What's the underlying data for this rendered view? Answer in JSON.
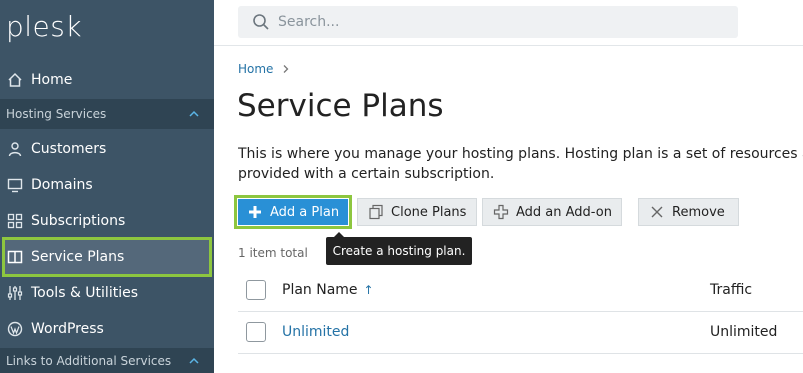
{
  "sidebar": {
    "logo": "plesk",
    "home": "Home",
    "hosting_section": "Hosting Services",
    "items": [
      {
        "label": "Customers",
        "icon": "user-icon"
      },
      {
        "label": "Domains",
        "icon": "monitor-icon"
      },
      {
        "label": "Subscriptions",
        "icon": "grid-icon"
      },
      {
        "label": "Service Plans",
        "icon": "book-icon"
      },
      {
        "label": "Tools & Utilities",
        "icon": "sliders-icon"
      },
      {
        "label": "WordPress",
        "icon": "wordpress-icon"
      }
    ],
    "links_section": "Links to Additional Services"
  },
  "search": {
    "placeholder": "Search..."
  },
  "breadcrumb": {
    "home": "Home"
  },
  "page": {
    "title": "Service Plans",
    "description_line1": "This is where you manage your hosting plans. Hosting plan is a set of resources and ser",
    "description_line2": "provided with a certain subscription."
  },
  "toolbar": {
    "add_plan": "Add a Plan",
    "clone_plans": "Clone Plans",
    "add_addon": "Add an Add-on",
    "remove": "Remove"
  },
  "tooltip": "Create a hosting plan.",
  "list": {
    "total": "1 item total",
    "columns": {
      "name": "Plan Name",
      "sort_indicator": "↑",
      "traffic": "Traffic"
    },
    "rows": [
      {
        "name": "Unlimited",
        "traffic": "Unlimited"
      }
    ]
  },
  "colors": {
    "sidebar_bg": "#3d5466",
    "highlight": "#8dc63f",
    "primary": "#2990d6",
    "link": "#2573a6"
  }
}
